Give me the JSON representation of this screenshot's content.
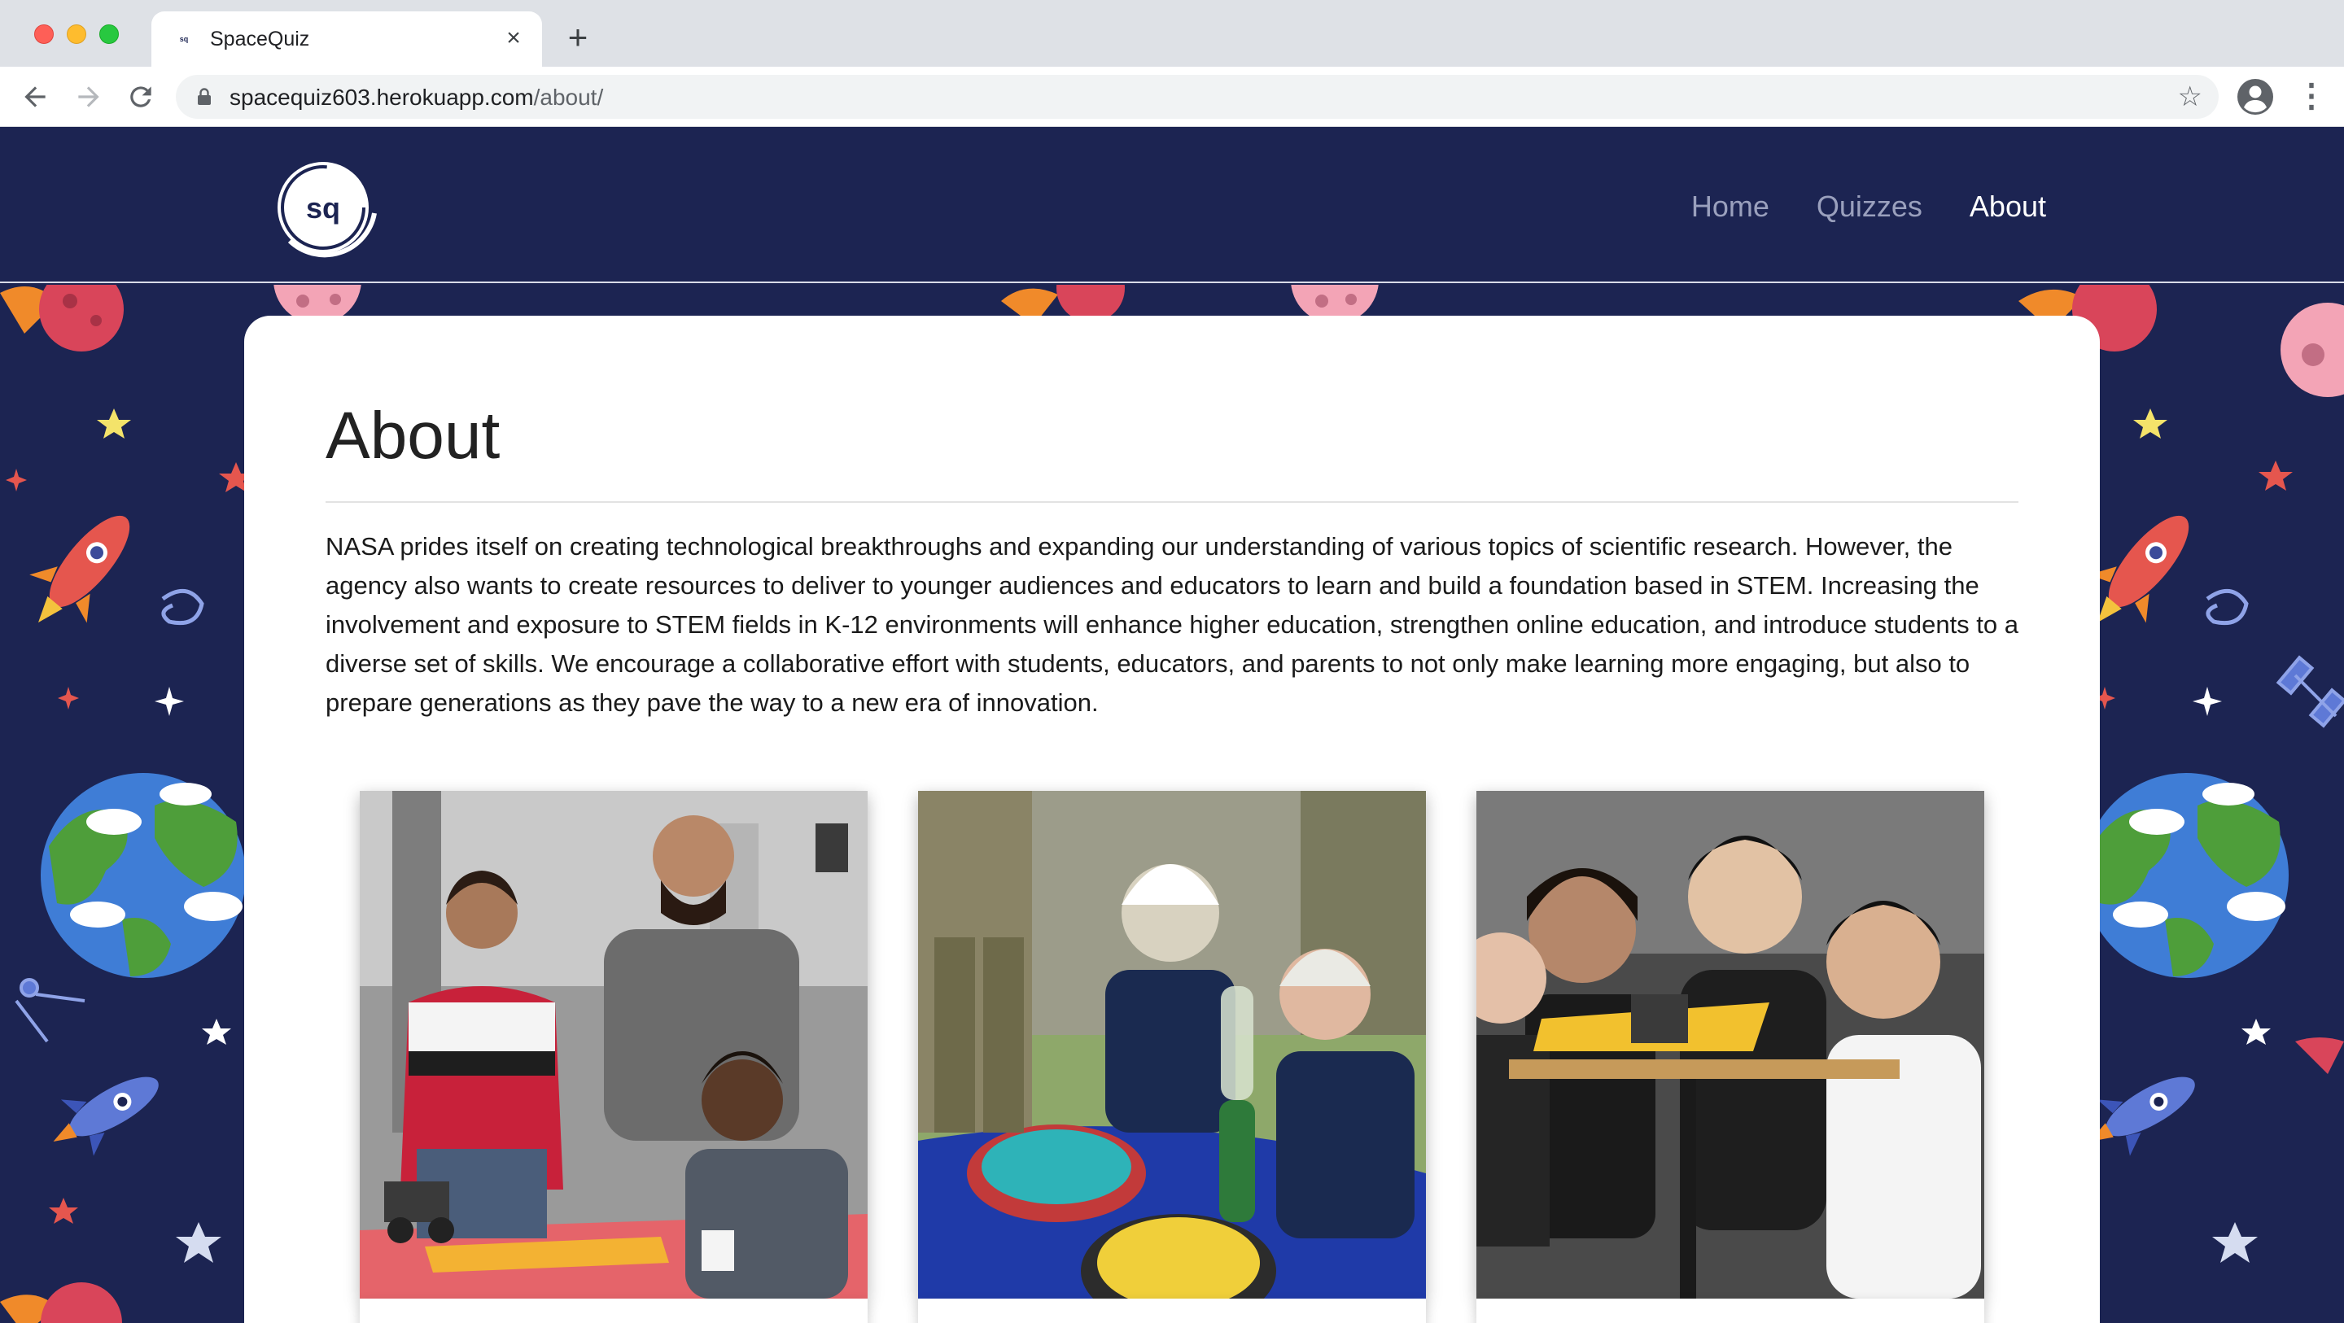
{
  "browser": {
    "tab_title": "SpaceQuiz",
    "tab_favicon_text": "sq",
    "url_domain": "spacequiz603.herokuapp.com",
    "url_path": "/about/"
  },
  "site": {
    "logo_text": "sq",
    "nav": [
      {
        "label": "Home",
        "active": false
      },
      {
        "label": "Quizzes",
        "active": false
      },
      {
        "label": "About",
        "active": true
      }
    ]
  },
  "about": {
    "title": "About",
    "body": "NASA prides itself on creating technological breakthroughs and expanding our understanding of various topics of scientific research. However, the agency also wants to create resources to deliver to younger audiences and educators to learn and build a foundation based in STEM. Increasing the involvement and exposure to STEM fields in K-12 environments will enhance higher education, strengthen online education, and introduce students to a diverse set of skills. We encourage a collaborative effort with students, educators, and parents to not only make learning more engaging, but also to prepare generations as they pave the way to a new era of innovation."
  },
  "colors": {
    "navy": "#1c2452",
    "nav_inactive": "#9aa0bd",
    "white": "#ffffff"
  }
}
